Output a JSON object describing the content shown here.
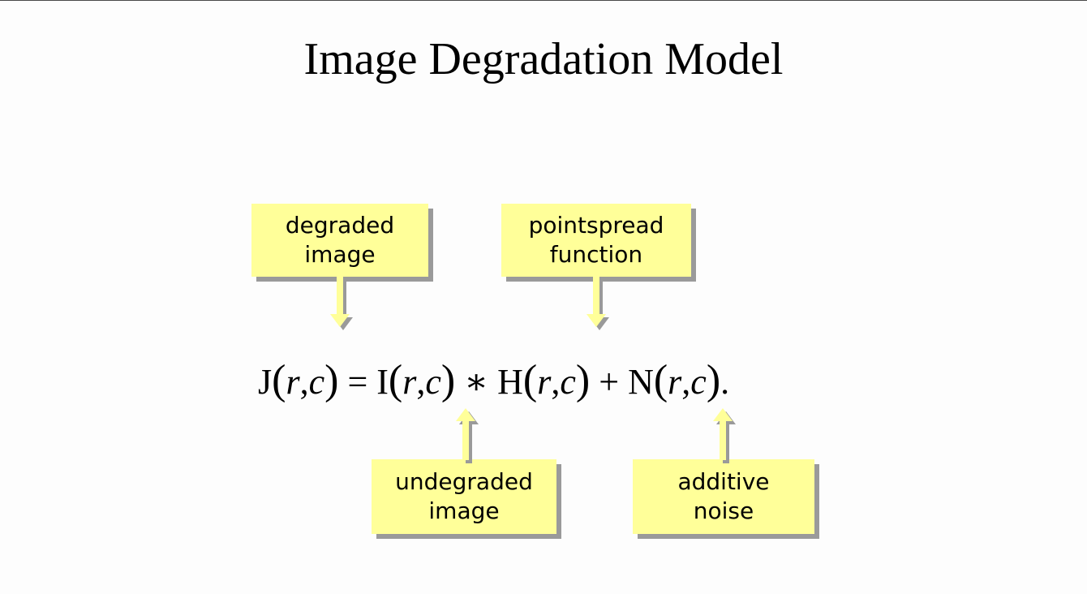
{
  "title": "Image Degradation Model",
  "equation": {
    "J": "J",
    "I": "I",
    "H": "H",
    "N": "N",
    "r": "r",
    "c": "c",
    "comma": ",",
    "open": "(",
    "close": ")",
    "eq": "=",
    "conv": "∗",
    "plus": "+",
    "period": "."
  },
  "callouts": {
    "degraded": [
      "degraded",
      "image"
    ],
    "psf": [
      "pointspread",
      "function"
    ],
    "undegraded": [
      "undegraded",
      "image"
    ],
    "noise": [
      "additive",
      "noise"
    ]
  },
  "colors": {
    "callout_fill": "#ffff99",
    "shadow": "#9a9a9a"
  }
}
